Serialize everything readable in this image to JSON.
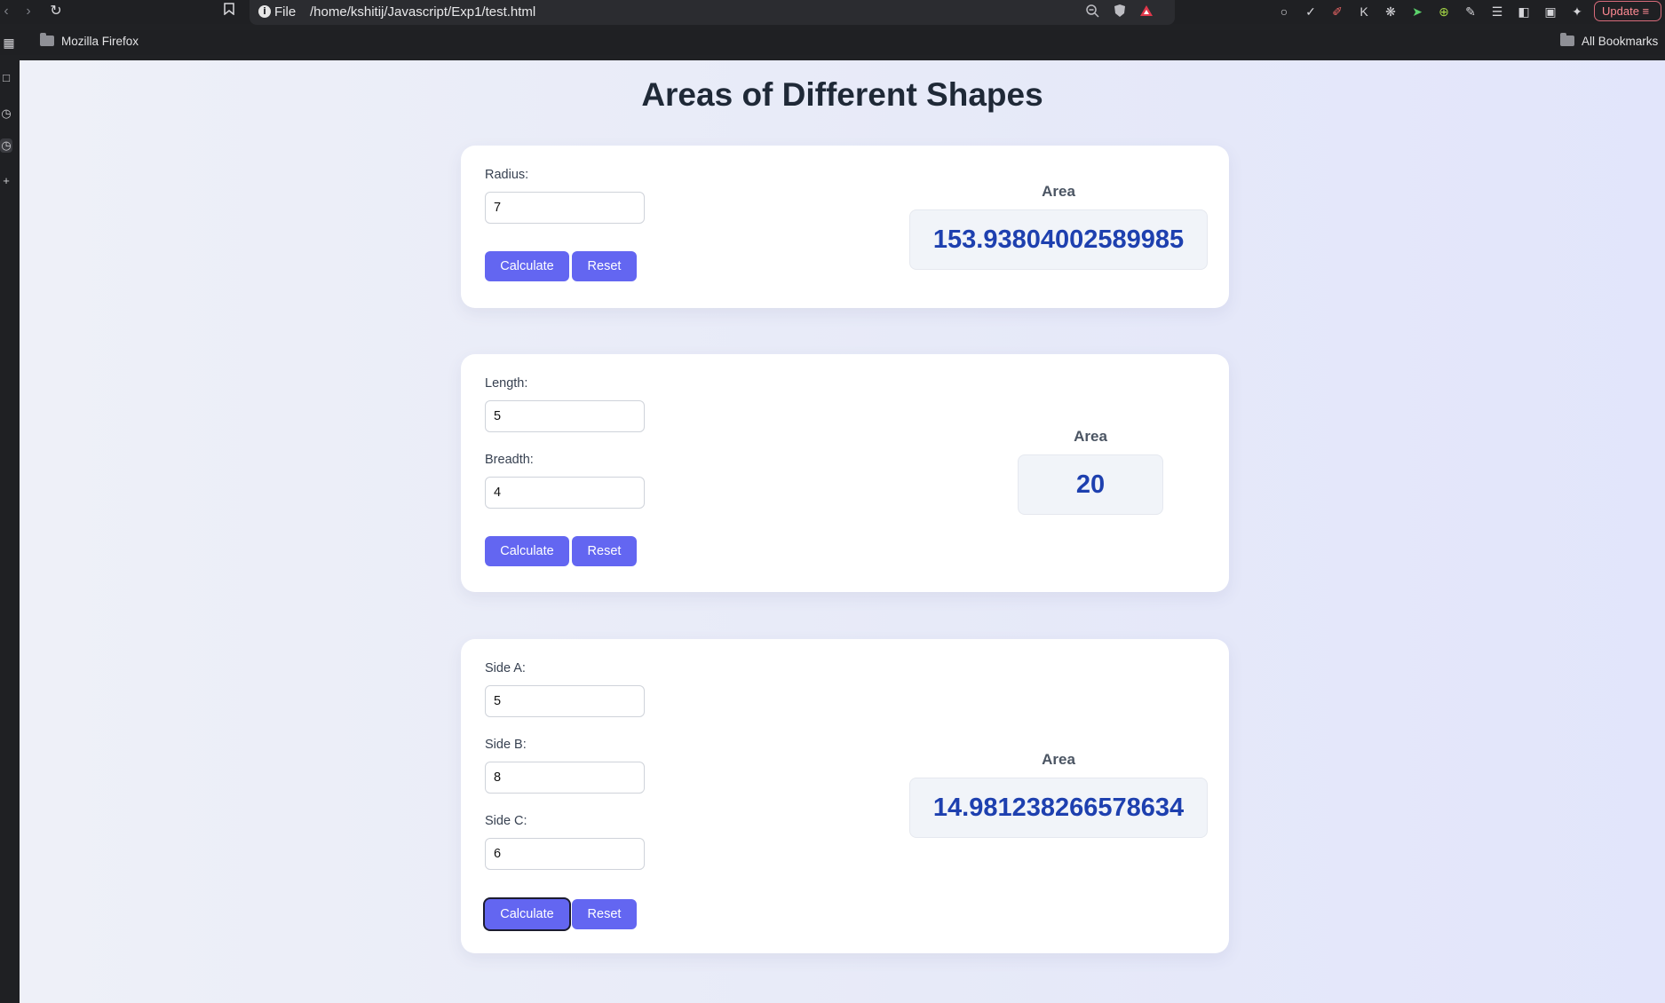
{
  "browser": {
    "url_scheme": "File",
    "url_path": "/home/kshitij/Javascript/Exp1/test.html",
    "update_label": "Update",
    "bookmarks": [
      {
        "label": "Mozilla Firefox"
      },
      {
        "label": "All Bookmarks"
      }
    ]
  },
  "page": {
    "title": "Areas of Different Shapes",
    "circle": {
      "radius_label": "Radius:",
      "radius_value": "7",
      "calculate_label": "Calculate",
      "reset_label": "Reset",
      "result_title": "Area",
      "result_value": "153.93804002589985"
    },
    "rectangle": {
      "length_label": "Length:",
      "length_value": "5",
      "breadth_label": "Breadth:",
      "breadth_value": "4",
      "calculate_label": "Calculate",
      "reset_label": "Reset",
      "result_title": "Area",
      "result_value": "20"
    },
    "triangle": {
      "side_a_label": "Side A:",
      "side_a_value": "5",
      "side_b_label": "Side B:",
      "side_b_value": "8",
      "side_c_label": "Side C:",
      "side_c_value": "6",
      "calculate_label": "Calculate",
      "reset_label": "Reset",
      "result_title": "Area",
      "result_value": "14.981238266578634"
    }
  },
  "colors": {
    "accent": "#6366f1",
    "result_text": "#1e40af",
    "page_bg": "#eef0f8"
  }
}
